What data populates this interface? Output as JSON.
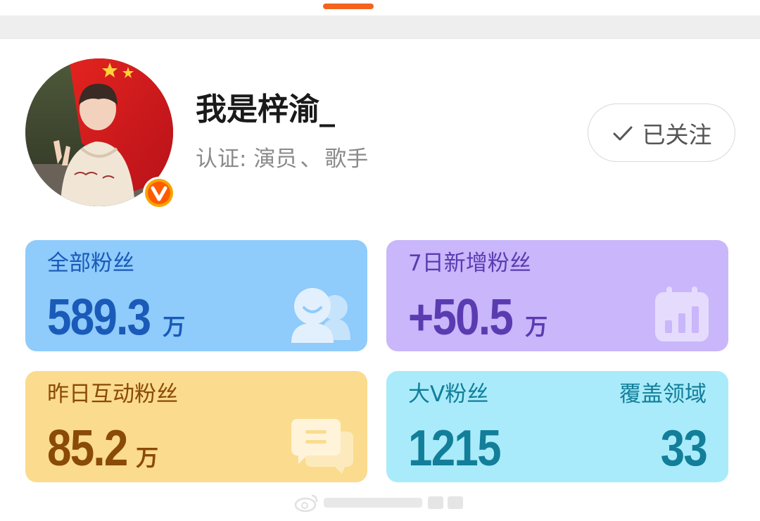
{
  "colors": {
    "accent": "#f4631e",
    "fans_card_bg": "#8fcbfb",
    "fans_text": "#1a5ab8",
    "new_card_bg": "#c9b6fb",
    "new_text": "#5b3bb0",
    "interact_card_bg": "#fbdb8d",
    "interact_text": "#8a4a09",
    "bigv_card_bg": "#a9ebfa",
    "bigv_text": "#127e9a"
  },
  "profile": {
    "name": "我是梓渝_",
    "verification_label": "认证:",
    "verification_roles": [
      "演员",
      "歌手"
    ],
    "verification_separator": "、",
    "verified_badge_icon": "orange-v-badge-icon"
  },
  "follow_button": {
    "label": "已关注",
    "icon": "checkmark-icon"
  },
  "stats": {
    "total_fans": {
      "label": "全部粉丝",
      "value": "589.3",
      "unit": "万",
      "icon": "smiley-people-icon"
    },
    "new_fans_7d": {
      "label": "7日新增粉丝",
      "value": "+50.5",
      "unit": "万",
      "icon": "calendar-chart-icon"
    },
    "interactive_fans_yesterday": {
      "label": "昨日互动粉丝",
      "value": "85.2",
      "unit": "万",
      "icon": "chat-bubbles-icon"
    },
    "big_v_fans": {
      "label": "大V粉丝",
      "value": "1215"
    },
    "coverage_fields": {
      "label": "覆盖领域",
      "value": "33"
    }
  }
}
